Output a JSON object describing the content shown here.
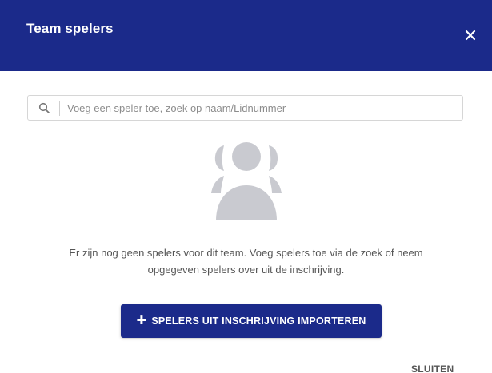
{
  "header": {
    "title": "Team spelers"
  },
  "search": {
    "placeholder": "Voeg een speler toe, zoek op naam/Lidnummer",
    "value": ""
  },
  "empty_state": {
    "message_line1": "Er zijn nog geen spelers voor dit team. Voeg spelers toe via de zoek of neem",
    "message_line2": "opgegeven spelers over uit de inschrijving.",
    "icon": "users-group-icon"
  },
  "actions": {
    "import_label": "SPELERS UIT INSCHRIJVING IMPORTEREN",
    "import_icon": "plus-icon",
    "close_label": "SLUITEN",
    "close_icon": "close-icon"
  },
  "colors": {
    "primary": "#1b2a8a",
    "illustration": "#c9cad0"
  }
}
